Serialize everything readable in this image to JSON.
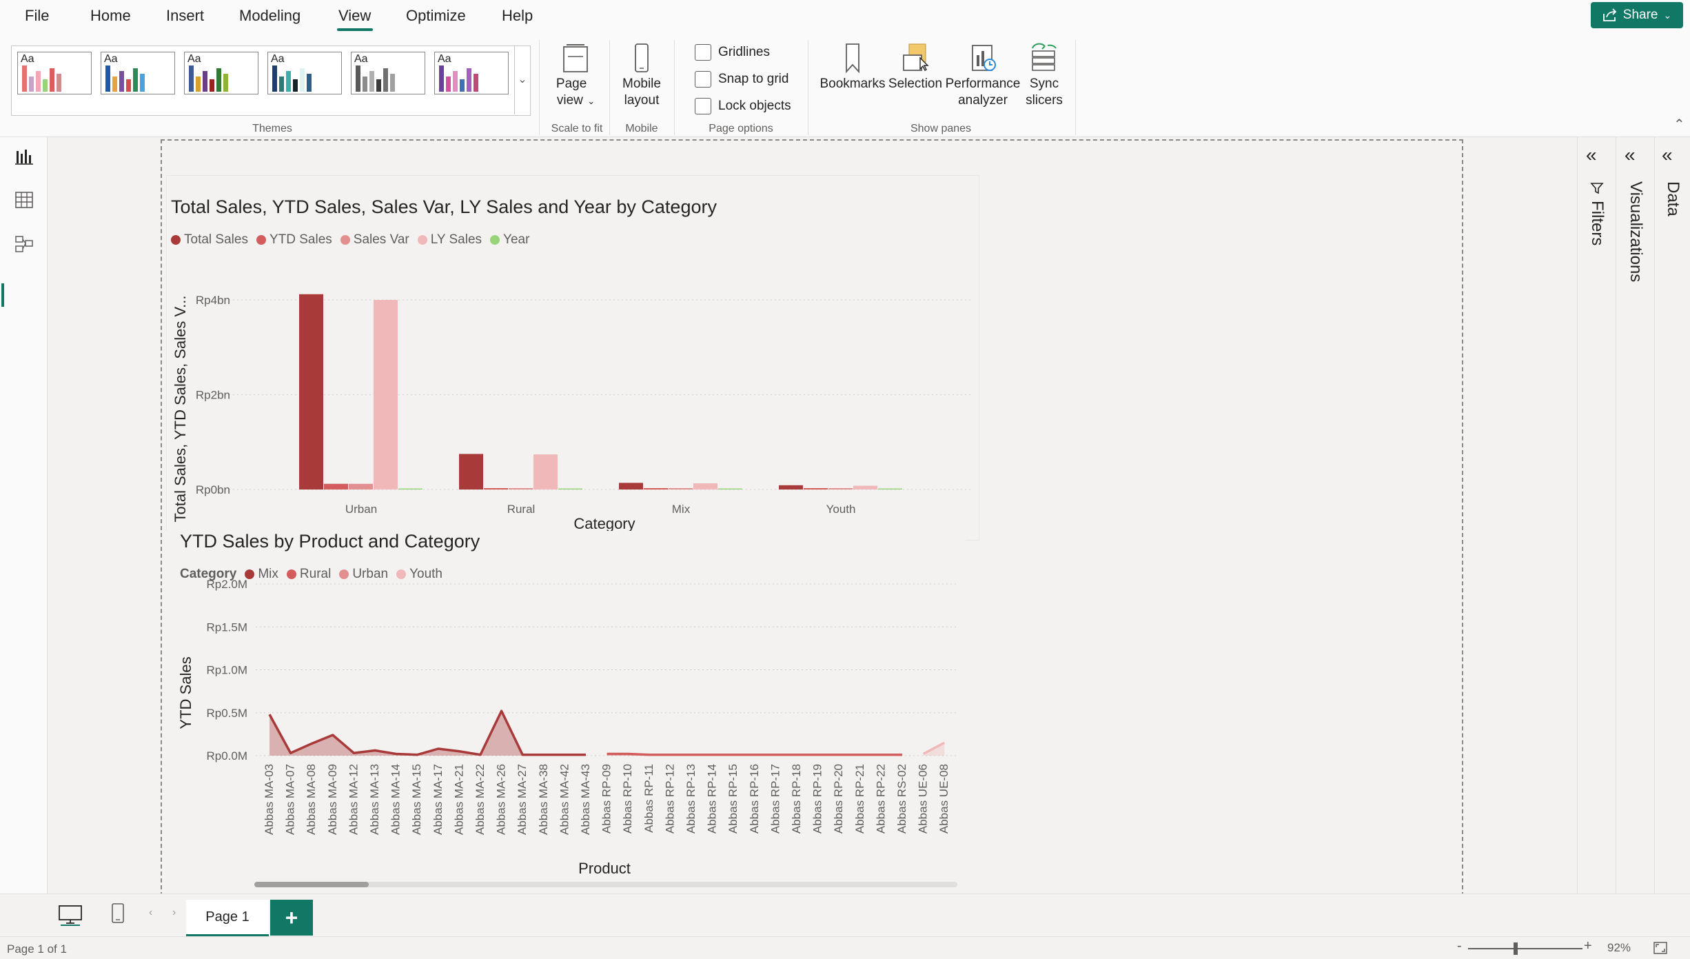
{
  "menu": {
    "items": [
      "File",
      "Home",
      "Insert",
      "Modeling",
      "View",
      "Optimize",
      "Help"
    ],
    "active": "View",
    "share_label": "Share"
  },
  "ribbon": {
    "themes": {
      "label": "Themes",
      "thumbnail_text": "Aa",
      "swatches": [
        [
          "#e8716d",
          "#c8a2c8",
          "#f3a6b6",
          "#9ad47a",
          "#e05b5b",
          "#d18b8b"
        ],
        [
          "#1f5aa6",
          "#e8a33d",
          "#7a4fa0",
          "#d64b4b",
          "#2e8b57",
          "#4aa3df"
        ],
        [
          "#3d5a99",
          "#d9a02b",
          "#6c3e87",
          "#9e1f1f",
          "#2e7d32",
          "#8fb339"
        ],
        [
          "#1d3f6e",
          "#2b7a78",
          "#3aafa9",
          "#17252a",
          "#def2f1",
          "#2c5f8a"
        ],
        [
          "#5a5a5a",
          "#8c8c8c",
          "#b0b0b0",
          "#3c3c3c",
          "#707070",
          "#a0a0a0"
        ],
        [
          "#6b3fa0",
          "#d64fa0",
          "#e08fc0",
          "#3f6fb5",
          "#a45fbf",
          "#c04a7a"
        ]
      ]
    },
    "scale": {
      "label": "Scale to fit",
      "page_view_label": "Page view"
    },
    "mobile": {
      "label": "Mobile",
      "mobile_layout_label": "Mobile layout"
    },
    "page_options": {
      "label": "Page options",
      "gridlines": "Gridlines",
      "snap_to_grid": "Snap to grid",
      "lock_objects": "Lock objects"
    },
    "show_panes": {
      "label": "Show panes",
      "bookmarks": "Bookmarks",
      "selection": "Selection",
      "performance_analyzer": "Performance analyzer",
      "sync_slicers": "Sync slicers"
    }
  },
  "colors": {
    "accent": "#117865",
    "total_sales": "#a83a3a",
    "ytd_sales": "#d35c5c",
    "sales_var": "#e28f8f",
    "ly_sales": "#f0b8b8",
    "year": "#9ad47a"
  },
  "chart1": {
    "title": "Total Sales, YTD Sales, Sales Var, LY Sales and Year by Category",
    "ylabel": "Total Sales, YTD Sales, Sales V...",
    "xlabel": "Category"
  },
  "chart2": {
    "title": "YTD Sales by Product and Category",
    "legend_title": "Category",
    "ylabel": "YTD Sales",
    "xlabel": "Product"
  },
  "chart_data": [
    {
      "type": "bar",
      "title": "Total Sales, YTD Sales, Sales Var, LY Sales and Year by Category",
      "xlabel": "Category",
      "ylabel": "Total Sales, YTD Sales, Sales V...",
      "categories": [
        "Urban",
        "Rural",
        "Mix",
        "Youth"
      ],
      "yticks": [
        "Rp0bn",
        "Rp2bn",
        "Rp4bn"
      ],
      "ylim": [
        0,
        4
      ],
      "units": "Rp bn",
      "legend_position": "top-left",
      "series": [
        {
          "name": "Total Sales",
          "values": [
            4.12,
            0.75,
            0.14,
            0.09
          ]
        },
        {
          "name": "YTD Sales",
          "values": [
            0.12,
            0.02,
            0.01,
            0.01
          ]
        },
        {
          "name": "Sales Var",
          "values": [
            0.12,
            0.02,
            0.01,
            0.01
          ]
        },
        {
          "name": "LY Sales",
          "values": [
            4.0,
            0.74,
            0.13,
            0.08
          ]
        },
        {
          "name": "Year",
          "values": [
            0.0,
            0.0,
            0.0,
            0.0
          ]
        }
      ]
    },
    {
      "type": "area",
      "title": "YTD Sales by Product and Category",
      "xlabel": "Product",
      "ylabel": "YTD Sales",
      "legend_title": "Category",
      "legend_position": "top-left",
      "yticks": [
        "Rp0.0M",
        "Rp0.5M",
        "Rp1.0M",
        "Rp1.5M",
        "Rp2.0M"
      ],
      "ylim": [
        0,
        2.0
      ],
      "units": "Rp M",
      "categories": [
        "Abbas MA-03",
        "Abbas MA-07",
        "Abbas MA-08",
        "Abbas MA-09",
        "Abbas MA-12",
        "Abbas MA-13",
        "Abbas MA-14",
        "Abbas MA-15",
        "Abbas MA-17",
        "Abbas MA-21",
        "Abbas MA-22",
        "Abbas MA-26",
        "Abbas MA-27",
        "Abbas MA-38",
        "Abbas MA-42",
        "Abbas MA-43",
        "Abbas RP-09",
        "Abbas RP-10",
        "Abbas RP-11",
        "Abbas RP-12",
        "Abbas RP-13",
        "Abbas RP-14",
        "Abbas RP-15",
        "Abbas RP-16",
        "Abbas RP-17",
        "Abbas RP-18",
        "Abbas RP-19",
        "Abbas RP-20",
        "Abbas RP-21",
        "Abbas RP-22",
        "Abbas RS-02",
        "Abbas UE-06",
        "Abbas UE-08"
      ],
      "series": [
        {
          "name": "Mix",
          "values": [
            0.48,
            0.03,
            0.14,
            0.24,
            0.03,
            0.06,
            0.02,
            0.01,
            0.08,
            0.05,
            0.01,
            0.52,
            0.01,
            0.01,
            0.01,
            0.01,
            null,
            null,
            null,
            null,
            null,
            null,
            null,
            null,
            null,
            null,
            null,
            null,
            null,
            null,
            null,
            null,
            null
          ]
        },
        {
          "name": "Rural",
          "values": [
            null,
            null,
            null,
            null,
            null,
            null,
            null,
            null,
            null,
            null,
            null,
            null,
            null,
            null,
            null,
            null,
            0.02,
            0.02,
            0.01,
            0.01,
            0.01,
            0.01,
            0.01,
            0.01,
            0.01,
            0.01,
            0.01,
            0.01,
            0.01,
            0.01,
            0.01,
            null,
            null
          ]
        },
        {
          "name": "Urban",
          "values": [
            null,
            null,
            null,
            null,
            null,
            null,
            null,
            null,
            null,
            null,
            null,
            null,
            null,
            null,
            null,
            null,
            null,
            null,
            null,
            null,
            null,
            null,
            null,
            null,
            null,
            null,
            null,
            null,
            null,
            null,
            null,
            null,
            null
          ]
        },
        {
          "name": "Youth",
          "values": [
            null,
            null,
            null,
            null,
            null,
            null,
            null,
            null,
            null,
            null,
            null,
            null,
            null,
            null,
            null,
            null,
            null,
            null,
            null,
            null,
            null,
            null,
            null,
            null,
            null,
            null,
            null,
            null,
            null,
            null,
            null,
            0.02,
            0.15
          ]
        }
      ]
    }
  ],
  "right_panes": {
    "filters": "Filters",
    "visualizations": "Visualizations",
    "data": "Data"
  },
  "bottom": {
    "page_tab": "Page 1",
    "add_page": "+",
    "status": "Page 1 of 1",
    "zoom": "92%"
  }
}
